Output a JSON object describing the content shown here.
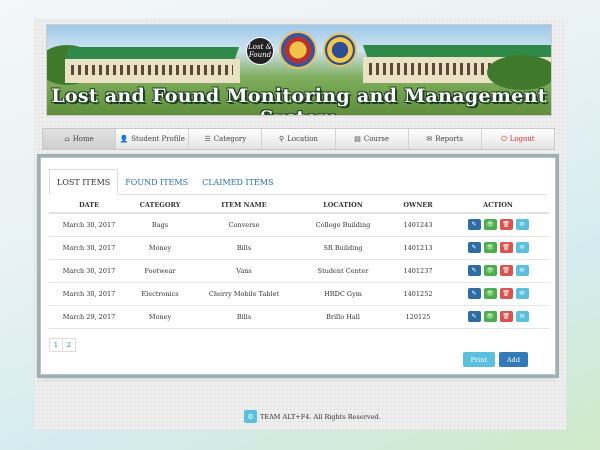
{
  "banner": {
    "title": "Lost and Found Monitoring and Management System",
    "logo_text": "Lost & Found"
  },
  "nav": [
    {
      "label": "Home",
      "icon": "home-icon",
      "glyph": "⌂",
      "active": true
    },
    {
      "label": "Student Profile",
      "icon": "user-icon",
      "glyph": "👤",
      "active": false
    },
    {
      "label": "Category",
      "icon": "list-icon",
      "glyph": "☰",
      "active": false
    },
    {
      "label": "Location",
      "icon": "map-marker-icon",
      "glyph": "⚲",
      "active": false
    },
    {
      "label": "Course",
      "icon": "book-icon",
      "glyph": "▤",
      "active": false
    },
    {
      "label": "Reports",
      "icon": "envelope-icon",
      "glyph": "✉",
      "active": false
    },
    {
      "label": "Logout",
      "icon": "logout-icon",
      "glyph": "⏻",
      "active": false
    }
  ],
  "tabs": {
    "lost": "LOST ITEMS",
    "found": "FOUND ITEMS",
    "claimed": "CLAIMED ITEMS"
  },
  "table": {
    "headers": {
      "date": "DATE",
      "category": "CATEGORY",
      "item": "ITEM NAME",
      "location": "LOCATION",
      "owner": "OWNER",
      "action": "ACTION"
    },
    "rows": [
      {
        "date": "March 30, 2017",
        "category": "Bags",
        "item": "Converse",
        "location": "College Building",
        "owner": "1401243"
      },
      {
        "date": "March 30, 2017",
        "category": "Money",
        "item": "Bills",
        "location": "SR Building",
        "owner": "1401213"
      },
      {
        "date": "March 30, 2017",
        "category": "Footwear",
        "item": "Vans",
        "location": "Student Center",
        "owner": "1401237"
      },
      {
        "date": "March 30, 2017",
        "category": "Electronics",
        "item": "Cherry Mobile Tablet",
        "location": "HRDC Gym",
        "owner": "1401252"
      },
      {
        "date": "March 29, 2017",
        "category": "Money",
        "item": "Bills",
        "location": "Brillo Hall",
        "owner": "120125"
      }
    ]
  },
  "pagination": {
    "page1": "1",
    "page2": "2"
  },
  "buttons": {
    "print": "Print",
    "add": "Add"
  },
  "footer": {
    "text": "TEAM ALT+F4. All Rights Reserved."
  },
  "colors": {
    "edit": "#2e6da4",
    "view": "#4cae4c",
    "delete": "#d9534f",
    "mail": "#5bc0de",
    "link": "#2a6fb0",
    "logout": "#d0342c"
  }
}
